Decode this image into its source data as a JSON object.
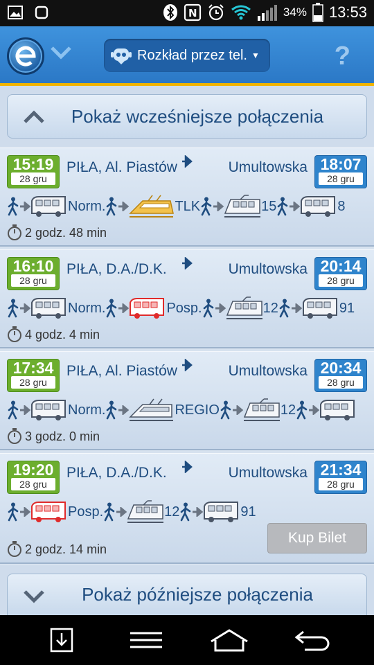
{
  "status_bar": {
    "battery": "34%",
    "time": "13:53"
  },
  "app_bar": {
    "mode_label": "Rozkład przez tel.",
    "help_label": "?"
  },
  "earlier_label": "Pokaż wcześniejsze połączenia",
  "later_label": "Pokaż późniejsze połączenia",
  "connections": [
    {
      "dep_time": "15:19",
      "dep_date": "28 gru",
      "from": "PIŁA, Al. Piastów",
      "to": "Umultowska",
      "arr_time": "18:07",
      "arr_date": "28 gru",
      "legs": [
        {
          "mode": "bus",
          "label": "Norm."
        },
        {
          "mode": "ic-train",
          "label": "TLK"
        },
        {
          "mode": "tram",
          "label": "15"
        },
        {
          "mode": "bus2",
          "label": "8"
        }
      ],
      "duration": "2 godz. 48 min"
    },
    {
      "dep_time": "16:10",
      "dep_date": "28 gru",
      "from": "PIŁA, D.A./D.K.",
      "to": "Umultowska",
      "arr_time": "20:14",
      "arr_date": "28 gru",
      "legs": [
        {
          "mode": "bus",
          "label": "Norm."
        },
        {
          "mode": "red-bus",
          "label": "Posp."
        },
        {
          "mode": "tram",
          "label": "12"
        },
        {
          "mode": "bus2",
          "label": "91"
        }
      ],
      "duration": "4 godz. 4 min"
    },
    {
      "dep_time": "17:34",
      "dep_date": "28 gru",
      "from": "PIŁA, Al. Piastów",
      "to": "Umultowska",
      "arr_time": "20:34",
      "arr_date": "28 gru",
      "legs": [
        {
          "mode": "bus",
          "label": "Norm."
        },
        {
          "mode": "regio-train",
          "label": "REGIO"
        },
        {
          "mode": "tram",
          "label": "12"
        },
        {
          "mode": "bus2",
          "label": ""
        }
      ],
      "duration": "3 godz. 0 min"
    },
    {
      "dep_time": "19:20",
      "dep_date": "28 gru",
      "from": "PIŁA, D.A./D.K.",
      "to": "Umultowska",
      "arr_time": "21:34",
      "arr_date": "28 gru",
      "legs": [
        {
          "mode": "red-bus",
          "label": "Posp."
        },
        {
          "mode": "tram",
          "label": "12"
        },
        {
          "mode": "bus2",
          "label": "91"
        }
      ],
      "duration": "2 godz. 14 min",
      "buy_label": "Kup Bilet"
    }
  ]
}
